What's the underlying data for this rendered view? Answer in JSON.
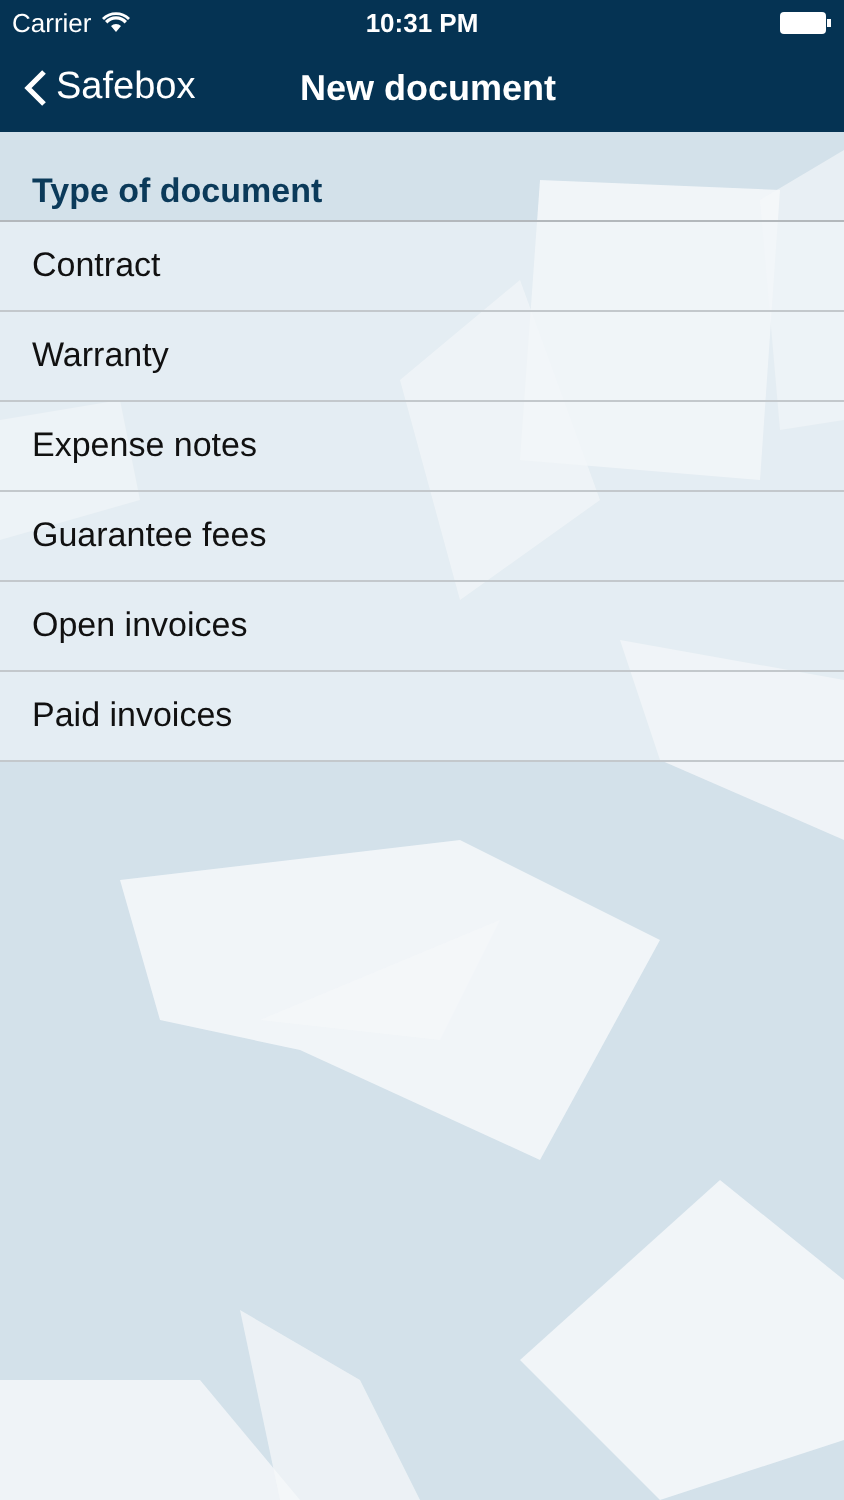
{
  "status_bar": {
    "carrier": "Carrier",
    "time": "10:31 PM"
  },
  "nav_bar": {
    "back": "Safebox",
    "title": "New document"
  },
  "section": {
    "title": "Type of document",
    "items": [
      {
        "label": "Contract"
      },
      {
        "label": "Warranty"
      },
      {
        "label": "Expense notes"
      },
      {
        "label": "Guarantee fees"
      },
      {
        "label": "Open invoices"
      },
      {
        "label": "Paid invoices"
      }
    ]
  }
}
